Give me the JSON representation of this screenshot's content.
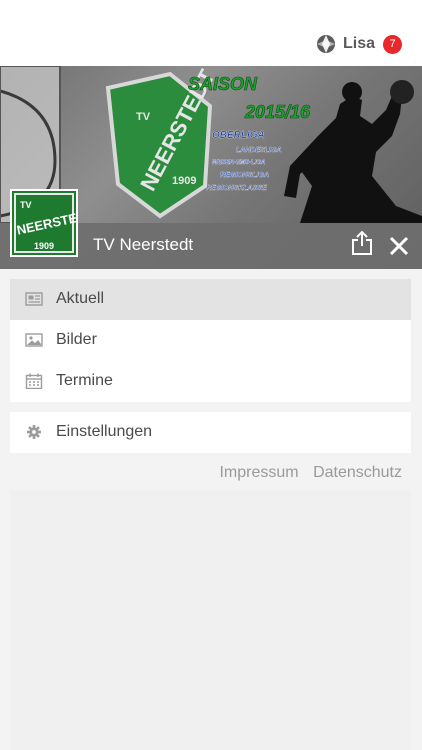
{
  "header": {
    "user_name": "Lisa",
    "notification_count": "7"
  },
  "banner": {
    "season_title": "SAISON",
    "season_year": "2015/16",
    "leagues": [
      "OBERLIGA",
      "LANDESLIGA",
      "WESER-EMS-LIGA",
      "REGIONSLIGA",
      "REGIONSKLASSE"
    ],
    "crest_text_top": "TV",
    "crest_text_main": "NEERSTEDT",
    "crest_year": "1909",
    "club_name": "TV Neerstedt"
  },
  "menu": {
    "main": [
      {
        "label": "Aktuell",
        "icon": "newspaper-icon",
        "active": true
      },
      {
        "label": "Bilder",
        "icon": "image-icon",
        "active": false
      },
      {
        "label": "Termine",
        "icon": "calendar-icon",
        "active": false
      }
    ],
    "settings_label": "Einstellungen"
  },
  "footer_links": {
    "impressum": "Impressum",
    "datenschutz": "Datenschutz"
  },
  "colors": {
    "badge": "#e8282b",
    "crest_green": "#1d7a2e",
    "season_text": "#1aa52a",
    "league_text": "#1a3d9c"
  }
}
